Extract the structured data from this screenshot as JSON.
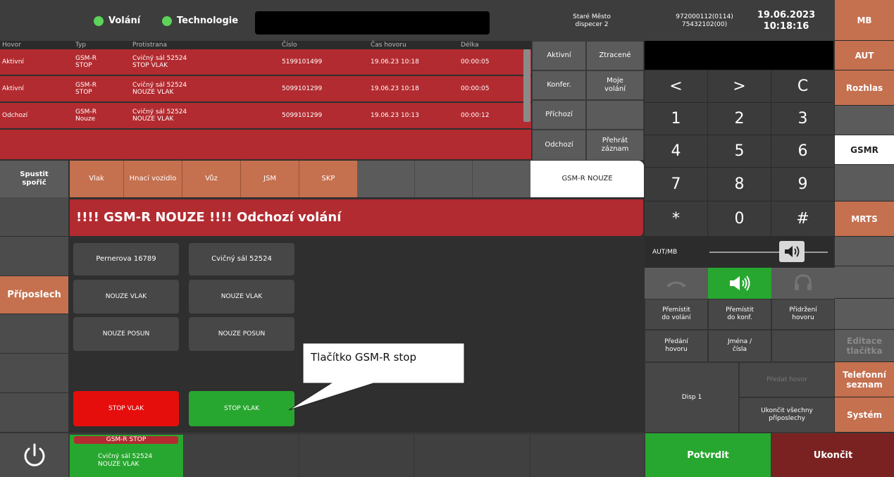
{
  "header": {
    "status1": "Volání",
    "status2": "Technologie",
    "location": "Staré Město",
    "dispatcher": "dispecer 2",
    "phone1": "972000112(0114)",
    "phone2": "75432102(00)",
    "date": "19.06.2023",
    "time": "10:18:16"
  },
  "calls": {
    "headers": [
      "Hovor",
      "Typ",
      "Protistrana",
      "Číslo",
      "Čas hovoru",
      "Délka"
    ],
    "rows": [
      {
        "state": "Aktivní",
        "type1": "GSM-R",
        "type2": "STOP",
        "party1": "Cvičný sál 52524",
        "party2": "STOP VLAK",
        "number": "5199101499",
        "time": "19.06.23 10:18",
        "duration": "00:00:05"
      },
      {
        "state": "Aktivní",
        "type1": "GSM-R",
        "type2": "STOP",
        "party1": "Cvičný sál 52524",
        "party2": "NOUZE VLAK",
        "number": "5099101299",
        "time": "19.06.23 10:18",
        "duration": "00:00:05"
      },
      {
        "state": "Odchozí",
        "type1": "GSM-R",
        "type2": "Nouze",
        "party1": "Cvičný sál 52524",
        "party2": "NOUZE VLAK",
        "number": "5099101299",
        "time": "19.06.23 10:13",
        "duration": "00:00:12"
      }
    ]
  },
  "filters": {
    "active": "Aktivní",
    "lost": "Ztracené",
    "conference": "Konfer.",
    "my1": "Moje",
    "my2": "volání",
    "incoming": "Příchozí",
    "outgoing": "Odchozí",
    "play1": "Přehrát",
    "play2": "záznam"
  },
  "keypad": {
    "keys": [
      "<",
      ">",
      "C",
      "1",
      "2",
      "3",
      "4",
      "5",
      "6",
      "7",
      "8",
      "9",
      "*",
      "0",
      "#"
    ]
  },
  "volume": {
    "label": "AUT/MB"
  },
  "actions": {
    "move_call1": "Přemístit",
    "move_call2": "do volání",
    "move_conf1": "Přemístit",
    "move_conf2": "do konf.",
    "hold1": "Přidržení",
    "hold2": "hovoru",
    "handover1": "Předání",
    "handover2": "hovoru",
    "names1": "Jména /",
    "names2": "čísla",
    "disp": "Disp 1",
    "pass_call": "Předat hovor",
    "end_all1": "Ukončit všechny",
    "end_all2": "příposlechy",
    "confirm": "Potvrdit",
    "end": "Ukončit"
  },
  "sidebar": {
    "items": [
      "MB",
      "AUT",
      "Rozhlas",
      "GSMR",
      "MRTS",
      "Editace tlačítka",
      "Telefonní seznam",
      "Systém"
    ]
  },
  "toolbar": {
    "screensaver1": "Spustit",
    "screensaver2": "spořič",
    "tabs": [
      "Vlak",
      "Hnací vozidlo",
      "Vůz",
      "JSM",
      "SKP"
    ],
    "active_tab": "GSM-R NOUZE"
  },
  "left": {
    "listen": "Příposlech"
  },
  "main": {
    "banner": "!!!! GSM-R NOUZE !!!! Odchozí volání",
    "col1": [
      "Pernerova 16789",
      "NOUZE VLAK",
      "NOUZE POSUN"
    ],
    "col2": [
      "Cvičný sál 52524",
      "NOUZE VLAK",
      "NOUZE POSUN"
    ],
    "stop1": "STOP VLAK",
    "stop2": "STOP VLAK",
    "callout": "Tlačítko GSM-R stop"
  },
  "bottom": {
    "card_header": "GSM-R STOP",
    "card_line1": "Cvičný sál 52524",
    "card_line2": "NOUZE VLAK"
  },
  "colors": {
    "call_row": "#b22b30",
    "tab_brown": "#c5704f",
    "green": "#27a72f",
    "stop_red": "#e60d0d",
    "end_red": "#7a2222"
  }
}
